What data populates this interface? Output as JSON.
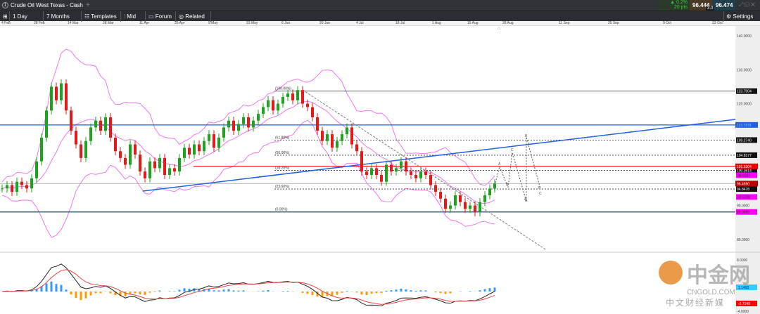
{
  "window": {
    "tab_number": "1",
    "title": "Crude Oil West Texas - Cash",
    "new_tab": "+"
  },
  "quote": {
    "change_pct": "▲ 0.2%",
    "change_pts": "20 pts",
    "bid": "96.444",
    "ask": "96.474",
    "spread": "3.0"
  },
  "toolbar": {
    "interval": "1 Day",
    "range": "7 Months",
    "templates": "Templates",
    "mid": "Mid",
    "forum": "Forum",
    "related": "Related",
    "settings": "Settings"
  },
  "colors": {
    "up": "#1ea31e",
    "down": "#e61919",
    "bands": "#ee77ee",
    "trend": "#1f5fe0",
    "fib": "#333333"
  },
  "x_axis": [
    "4 Feb",
    "28 Feb",
    "14 Mar",
    "28 Mar",
    "11 Apr",
    "25 Apr",
    "9 May",
    "23 May",
    "6 Jun",
    "20 Jun",
    "4 Jul",
    "18 Jul",
    "1 Aug",
    "15 Aug",
    "28 Aug",
    "11 Sep",
    "25 Sep",
    "9 Oct",
    "23 Oct"
  ],
  "price_axis": [
    "140.0000",
    "130.0000",
    "120.0000",
    "90.0000",
    "80.0000"
  ],
  "macd_axis": [
    "8.0000",
    "-4.0000"
  ],
  "fib_levels": [
    {
      "label": "(100.00%)",
      "value": 123.7004,
      "tag": "123.7004"
    },
    {
      "label": "(61.80%)",
      "value": 109.274,
      "tag": "109.2740"
    },
    {
      "label": "(50.00%)",
      "value": 104.8177,
      "tag": "104.8177"
    },
    {
      "label": "(38.20%)",
      "value": 100.3614,
      "tag": "100.3614"
    },
    {
      "label": "(23.60%)",
      "value": 94.8478,
      "tag": "94.8478"
    },
    {
      "label": "(0.00%)",
      "value": 88.0889,
      "tag": "88.0889"
    }
  ],
  "level_tags": {
    "blue": "113.7378",
    "red": "101.5304",
    "current": "96.4590",
    "band_upper": "98.9187",
    "band_lower": "92.5038"
  },
  "macd_tags": {
    "macd": "1.1493",
    "signal": "-2.7149"
  },
  "wave_labels": [
    "A",
    "B",
    "C",
    "A",
    "B",
    "A",
    "B",
    "C"
  ],
  "watermark": {
    "cn": "中金网",
    "site": "CNGOLD.COM",
    "slogan": "中 文 财 经 新 媒"
  },
  "chart_data": {
    "type": "candlestick",
    "closes": [
      95,
      96,
      94,
      97,
      96,
      95,
      98,
      103,
      110,
      118,
      125,
      121,
      126,
      118,
      112,
      108,
      104,
      109,
      113,
      115,
      112,
      116,
      110,
      106,
      104,
      102,
      108,
      105,
      100,
      98,
      103,
      101,
      104,
      99,
      101,
      100,
      104,
      107,
      105,
      108,
      106,
      109,
      111,
      107,
      110,
      113,
      115,
      112,
      114,
      116,
      113,
      115,
      117,
      119,
      121,
      118,
      120,
      122,
      123,
      121,
      124,
      120,
      119,
      116,
      112,
      109,
      111,
      107,
      109,
      111,
      113,
      108,
      106,
      100,
      99,
      101,
      99,
      97,
      102,
      100,
      101,
      103,
      100,
      99,
      98,
      100,
      99,
      96,
      94,
      92,
      89,
      90,
      93,
      91,
      89,
      90,
      88,
      91,
      93,
      95,
      96.5
    ],
    "ylim": [
      78,
      142
    ]
  }
}
